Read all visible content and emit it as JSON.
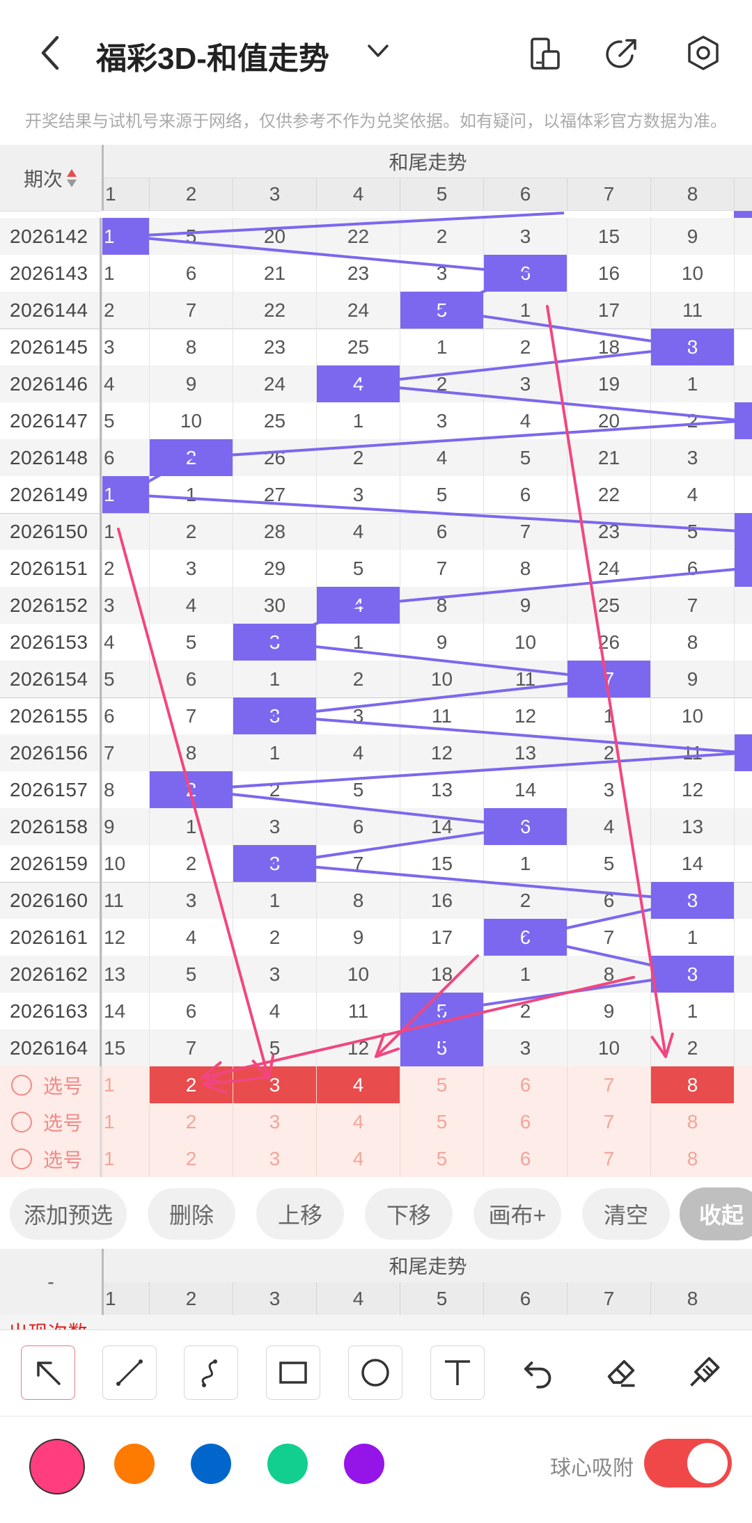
{
  "header": {
    "title": "福彩3D-和值走势",
    "notice": "开奖结果与试机号来源于网络，仅供参考不作为兑奖依据。如有疑问，以福体彩官方数据为准。"
  },
  "grid": {
    "period_header": "期次",
    "section_title": "和尾走势",
    "columns": [
      "1",
      "2",
      "3",
      "4",
      "5",
      "6",
      "7",
      "8"
    ],
    "rows": [
      {
        "period": "2026142",
        "values": [
          "1",
          "5",
          "20",
          "22",
          "2",
          "3",
          "15",
          "9"
        ],
        "hit": 0
      },
      {
        "period": "2026143",
        "values": [
          "1",
          "6",
          "21",
          "23",
          "3",
          "6",
          "16",
          "10"
        ],
        "hit": 5
      },
      {
        "period": "2026144",
        "values": [
          "2",
          "7",
          "22",
          "24",
          "5",
          "1",
          "17",
          "11"
        ],
        "hit": 4
      },
      {
        "period": "2026145",
        "values": [
          "3",
          "8",
          "23",
          "25",
          "1",
          "2",
          "18",
          "8"
        ],
        "hit": 7
      },
      {
        "period": "2026146",
        "values": [
          "4",
          "9",
          "24",
          "4",
          "2",
          "3",
          "19",
          "1"
        ],
        "hit": 3
      },
      {
        "period": "2026147",
        "values": [
          "5",
          "10",
          "25",
          "1",
          "3",
          "4",
          "20",
          "2"
        ],
        "hit": -1
      },
      {
        "period": "2026148",
        "values": [
          "6",
          "2",
          "26",
          "2",
          "4",
          "5",
          "21",
          "3"
        ],
        "hit": 1
      },
      {
        "period": "2026149",
        "values": [
          "1",
          "1",
          "27",
          "3",
          "5",
          "6",
          "22",
          "4"
        ],
        "hit": 0
      },
      {
        "period": "2026150",
        "values": [
          "1",
          "2",
          "28",
          "4",
          "6",
          "7",
          "23",
          "5"
        ],
        "hit": -1
      },
      {
        "period": "2026151",
        "values": [
          "2",
          "3",
          "29",
          "5",
          "7",
          "8",
          "24",
          "6"
        ],
        "hit": -1
      },
      {
        "period": "2026152",
        "values": [
          "3",
          "4",
          "30",
          "4",
          "8",
          "9",
          "25",
          "7"
        ],
        "hit": 3
      },
      {
        "period": "2026153",
        "values": [
          "4",
          "5",
          "3",
          "1",
          "9",
          "10",
          "26",
          "8"
        ],
        "hit": 2
      },
      {
        "period": "2026154",
        "values": [
          "5",
          "6",
          "1",
          "2",
          "10",
          "11",
          "7",
          "9"
        ],
        "hit": 6
      },
      {
        "period": "2026155",
        "values": [
          "6",
          "7",
          "3",
          "3",
          "11",
          "12",
          "1",
          "10"
        ],
        "hit": 2
      },
      {
        "period": "2026156",
        "values": [
          "7",
          "8",
          "1",
          "4",
          "12",
          "13",
          "2",
          "11"
        ],
        "hit": -1
      },
      {
        "period": "2026157",
        "values": [
          "8",
          "2",
          "2",
          "5",
          "13",
          "14",
          "3",
          "12"
        ],
        "hit": 1
      },
      {
        "period": "2026158",
        "values": [
          "9",
          "1",
          "3",
          "6",
          "14",
          "6",
          "4",
          "13"
        ],
        "hit": 5
      },
      {
        "period": "2026159",
        "values": [
          "10",
          "2",
          "3",
          "7",
          "15",
          "1",
          "5",
          "14"
        ],
        "hit": 2
      },
      {
        "period": "2026160",
        "values": [
          "11",
          "3",
          "1",
          "8",
          "16",
          "2",
          "6",
          "8"
        ],
        "hit": 7
      },
      {
        "period": "2026161",
        "values": [
          "12",
          "4",
          "2",
          "9",
          "17",
          "6",
          "7",
          "1"
        ],
        "hit": 5
      },
      {
        "period": "2026162",
        "values": [
          "13",
          "5",
          "3",
          "10",
          "18",
          "1",
          "8",
          "8"
        ],
        "hit": 7
      },
      {
        "period": "2026163",
        "values": [
          "14",
          "6",
          "4",
          "11",
          "5",
          "2",
          "9",
          "1"
        ],
        "hit": 4
      },
      {
        "period": "2026164",
        "values": [
          "15",
          "7",
          "5",
          "12",
          "5",
          "3",
          "10",
          "2"
        ],
        "hit": 4
      }
    ],
    "select_rows": [
      {
        "label": "选号",
        "values": [
          "1",
          "2",
          "3",
          "4",
          "5",
          "6",
          "7",
          "8"
        ],
        "selected": [
          1,
          2,
          3,
          7
        ]
      },
      {
        "label": "选号",
        "values": [
          "1",
          "2",
          "3",
          "4",
          "5",
          "6",
          "7",
          "8"
        ],
        "selected": []
      },
      {
        "label": "选号",
        "values": [
          "1",
          "2",
          "3",
          "4",
          "5",
          "6",
          "7",
          "8"
        ],
        "selected": []
      }
    ]
  },
  "actions": {
    "add_preselect": "添加预选",
    "delete": "删除",
    "move_up": "上移",
    "move_down": "下移",
    "canvas_plus": "画布+",
    "clear": "清空",
    "collapse": "收起"
  },
  "stats": {
    "dash": "-",
    "section_title": "和尾走势",
    "columns": [
      "1",
      "2",
      "3",
      "4",
      "5",
      "6",
      "7",
      "8"
    ],
    "row_label": "出现次数"
  },
  "toolbar": {
    "tools": [
      "arrow-tool-icon",
      "line-tool-icon",
      "curve-tool-icon",
      "rectangle-tool-icon",
      "circle-tool-icon",
      "text-tool-icon",
      "undo-icon",
      "eraser-icon",
      "clear-brush-icon"
    ],
    "colors": [
      "#ff3d7f",
      "#ff7a00",
      "#0066cc",
      "#12cf8f",
      "#9514e8"
    ],
    "snap_label": "球心吸附",
    "snap_on": true
  },
  "colors": {
    "hit": "#7b68ee",
    "selected": "#e84c4c",
    "draw_line": "#f2467e"
  }
}
